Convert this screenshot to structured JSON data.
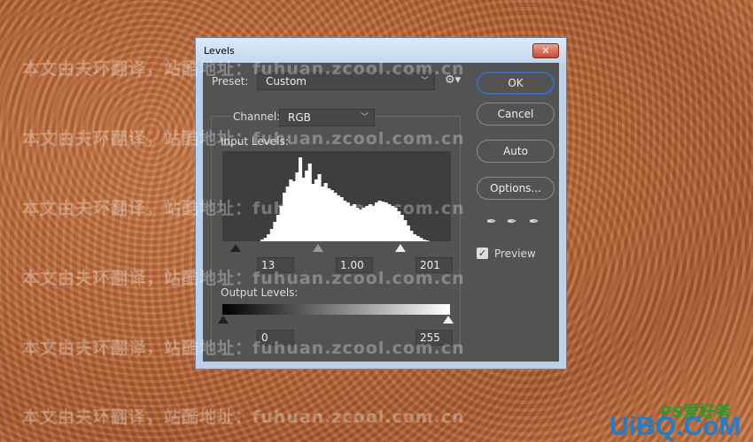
{
  "dialog": {
    "title": "Levels",
    "close_label": "✕",
    "preset_label": "Preset:",
    "preset_value": "Custom",
    "channel_label": "Channel:",
    "channel_value": "RGB",
    "input_levels_label": "Input Levels:",
    "output_levels_label": "Output Levels:",
    "input_black": "13",
    "input_gamma": "1.00",
    "input_white": "201",
    "output_black": "0",
    "output_white": "255",
    "buttons": {
      "ok": "OK",
      "cancel": "Cancel",
      "auto": "Auto",
      "options": "Options..."
    },
    "preview_label": "Preview",
    "preview_checked": true,
    "histogram": [
      0,
      0,
      0,
      0,
      0,
      0,
      0,
      0,
      0,
      0,
      0,
      0,
      2,
      4,
      8,
      14,
      22,
      30,
      40,
      55,
      62,
      70,
      68,
      78,
      95,
      72,
      80,
      88,
      65,
      70,
      76,
      62,
      66,
      60,
      58,
      55,
      52,
      50,
      46,
      44,
      40,
      42,
      38,
      36,
      38,
      40,
      42,
      40,
      44,
      46,
      45,
      44,
      42,
      40,
      38,
      34,
      30,
      24,
      18,
      12,
      8,
      6,
      4,
      2,
      1,
      0,
      0,
      0,
      0,
      0,
      0,
      0
    ]
  },
  "watermark": "本文由夫环翻译，站酷地址：fuhuan.zcool.com.cn",
  "logo": {
    "main": "UiBQ.CoM",
    "sub": "PS爱好者"
  }
}
